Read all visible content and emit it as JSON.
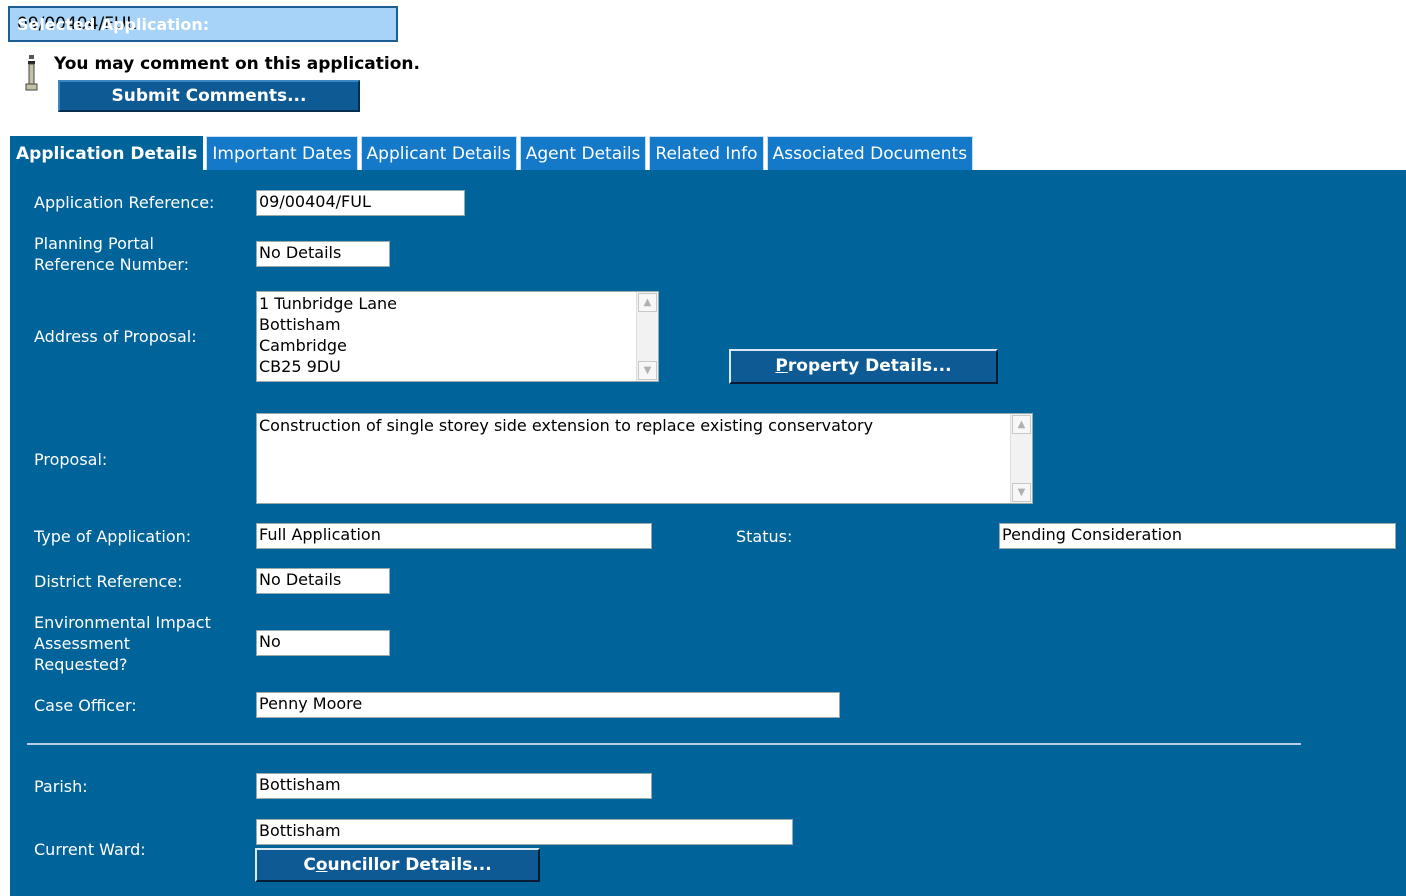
{
  "selected": {
    "label": "Selected Application:",
    "value": "09/00404/FUL"
  },
  "comment": {
    "text": "You may comment on this application.",
    "button": "Submit Comments..."
  },
  "tabs": [
    "Application Details",
    "Important Dates",
    "Applicant Details",
    "Agent Details",
    "Related Info",
    "Associated Documents"
  ],
  "fields": {
    "app_ref": {
      "label": "Application Reference:",
      "value": "09/00404/FUL"
    },
    "portal_ref": {
      "label1": "Planning Portal",
      "label2": "Reference Number:",
      "value": "No Details"
    },
    "address": {
      "label": "Address of Proposal:",
      "lines": [
        "1 Tunbridge Lane",
        "Bottisham",
        "Cambridge",
        "CB25 9DU"
      ]
    },
    "property_button": {
      "prefix": "P",
      "rest": "roperty Details..."
    },
    "proposal": {
      "label": "Proposal:",
      "value": "Construction of single storey side extension to replace existing conservatory"
    },
    "type": {
      "label": "Type of Application:",
      "value": "Full Application"
    },
    "status": {
      "label": "Status:",
      "value": "Pending Consideration"
    },
    "district_ref": {
      "label": "District Reference:",
      "value": "No Details"
    },
    "eia": {
      "label1": "Environmental Impact",
      "label2": "Assessment",
      "label3": "Requested?",
      "value": "No"
    },
    "officer": {
      "label": "Case Officer:",
      "value": "Penny Moore"
    },
    "parish": {
      "label": "Parish:",
      "value": "Bottisham"
    },
    "ward": {
      "label": "Current Ward:",
      "value": "Bottisham"
    },
    "councillor_button": {
      "prefix": "C",
      "u": "o",
      "rest": "uncillor Details..."
    }
  },
  "colors": {
    "panel": "#006399",
    "tab": "#1579c9",
    "selected_box": "#a6d3f7"
  },
  "icons": {
    "info": "info-person-icon",
    "scroll_up": "chevron-up-icon",
    "scroll_down": "chevron-down-icon"
  }
}
